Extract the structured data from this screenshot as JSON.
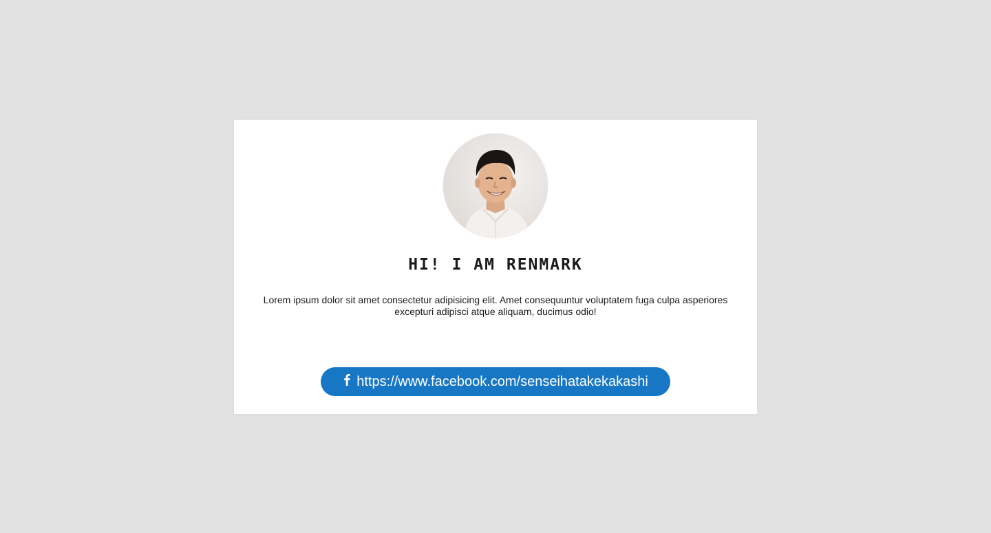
{
  "profile": {
    "avatar_alt": "Renmark",
    "heading": "HI! I AM RENMARK",
    "bio": "Lorem ipsum dolor sit amet consectetur adipisicing elit. Amet consequuntur voluptatem fuga culpa asperiores excepturi adipisci atque aliquam, ducimus odio!"
  },
  "social": {
    "facebook_url_text": "https://www.facebook.com/senseihatakekakashi",
    "facebook_icon": "facebook-f-icon"
  },
  "colors": {
    "background": "#e1e1e1",
    "card": "#ffffff",
    "button": "#1877c5",
    "button_text": "#ffffff",
    "heading": "#1b1b1b"
  }
}
